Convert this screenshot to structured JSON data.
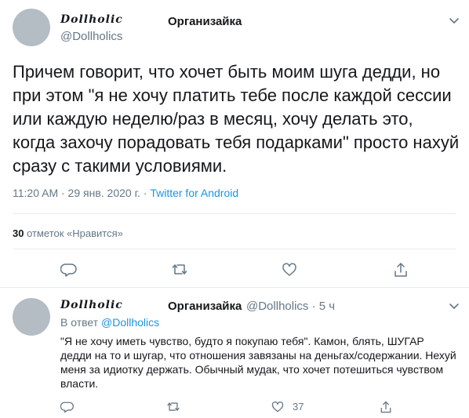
{
  "main_tweet": {
    "display_name": "Dollholic",
    "org_name": "Организайка",
    "handle": "@Dollholics",
    "text": "Причем говорит, что хочет быть моим шуга дедди, но при этом \"я не хочу платить тебе после каждой сессии или каждую неделю/раз в месяц, хочу делать это, когда захочу порадовать тебя подарками\" просто нахуй сразу с такими условиями.",
    "timestamp": "11:20 AM · 29 янв. 2020 г. · ",
    "source": "Twitter for Android",
    "likes_count": "30",
    "likes_label": " отметок «Нравится»"
  },
  "reply_tweet": {
    "display_name": "Dollholic",
    "org_name": "Организайка",
    "handle_time": "@Dollholics · 5 ч",
    "reply_prefix": "В ответ ",
    "reply_to": "@Dollholics",
    "text": "\"Я не хочу иметь чувство, будто я покупаю тебя\". Камон, блять, ШУГАР дедди на то и шугар, что отношения завязаны на деньгах/содержании. Нехуй меня за идиотку держать. Обычный мудак, что хочет потешиться чувством власти.",
    "like_count": "37"
  },
  "icons": [
    "chevron-down-icon",
    "reply-icon",
    "retweet-icon",
    "like-icon",
    "share-icon"
  ],
  "colors": {
    "link": "#1b95e0",
    "muted": "#657786",
    "divider": "#e6ecf0",
    "avatar": "#b4bcc4"
  }
}
